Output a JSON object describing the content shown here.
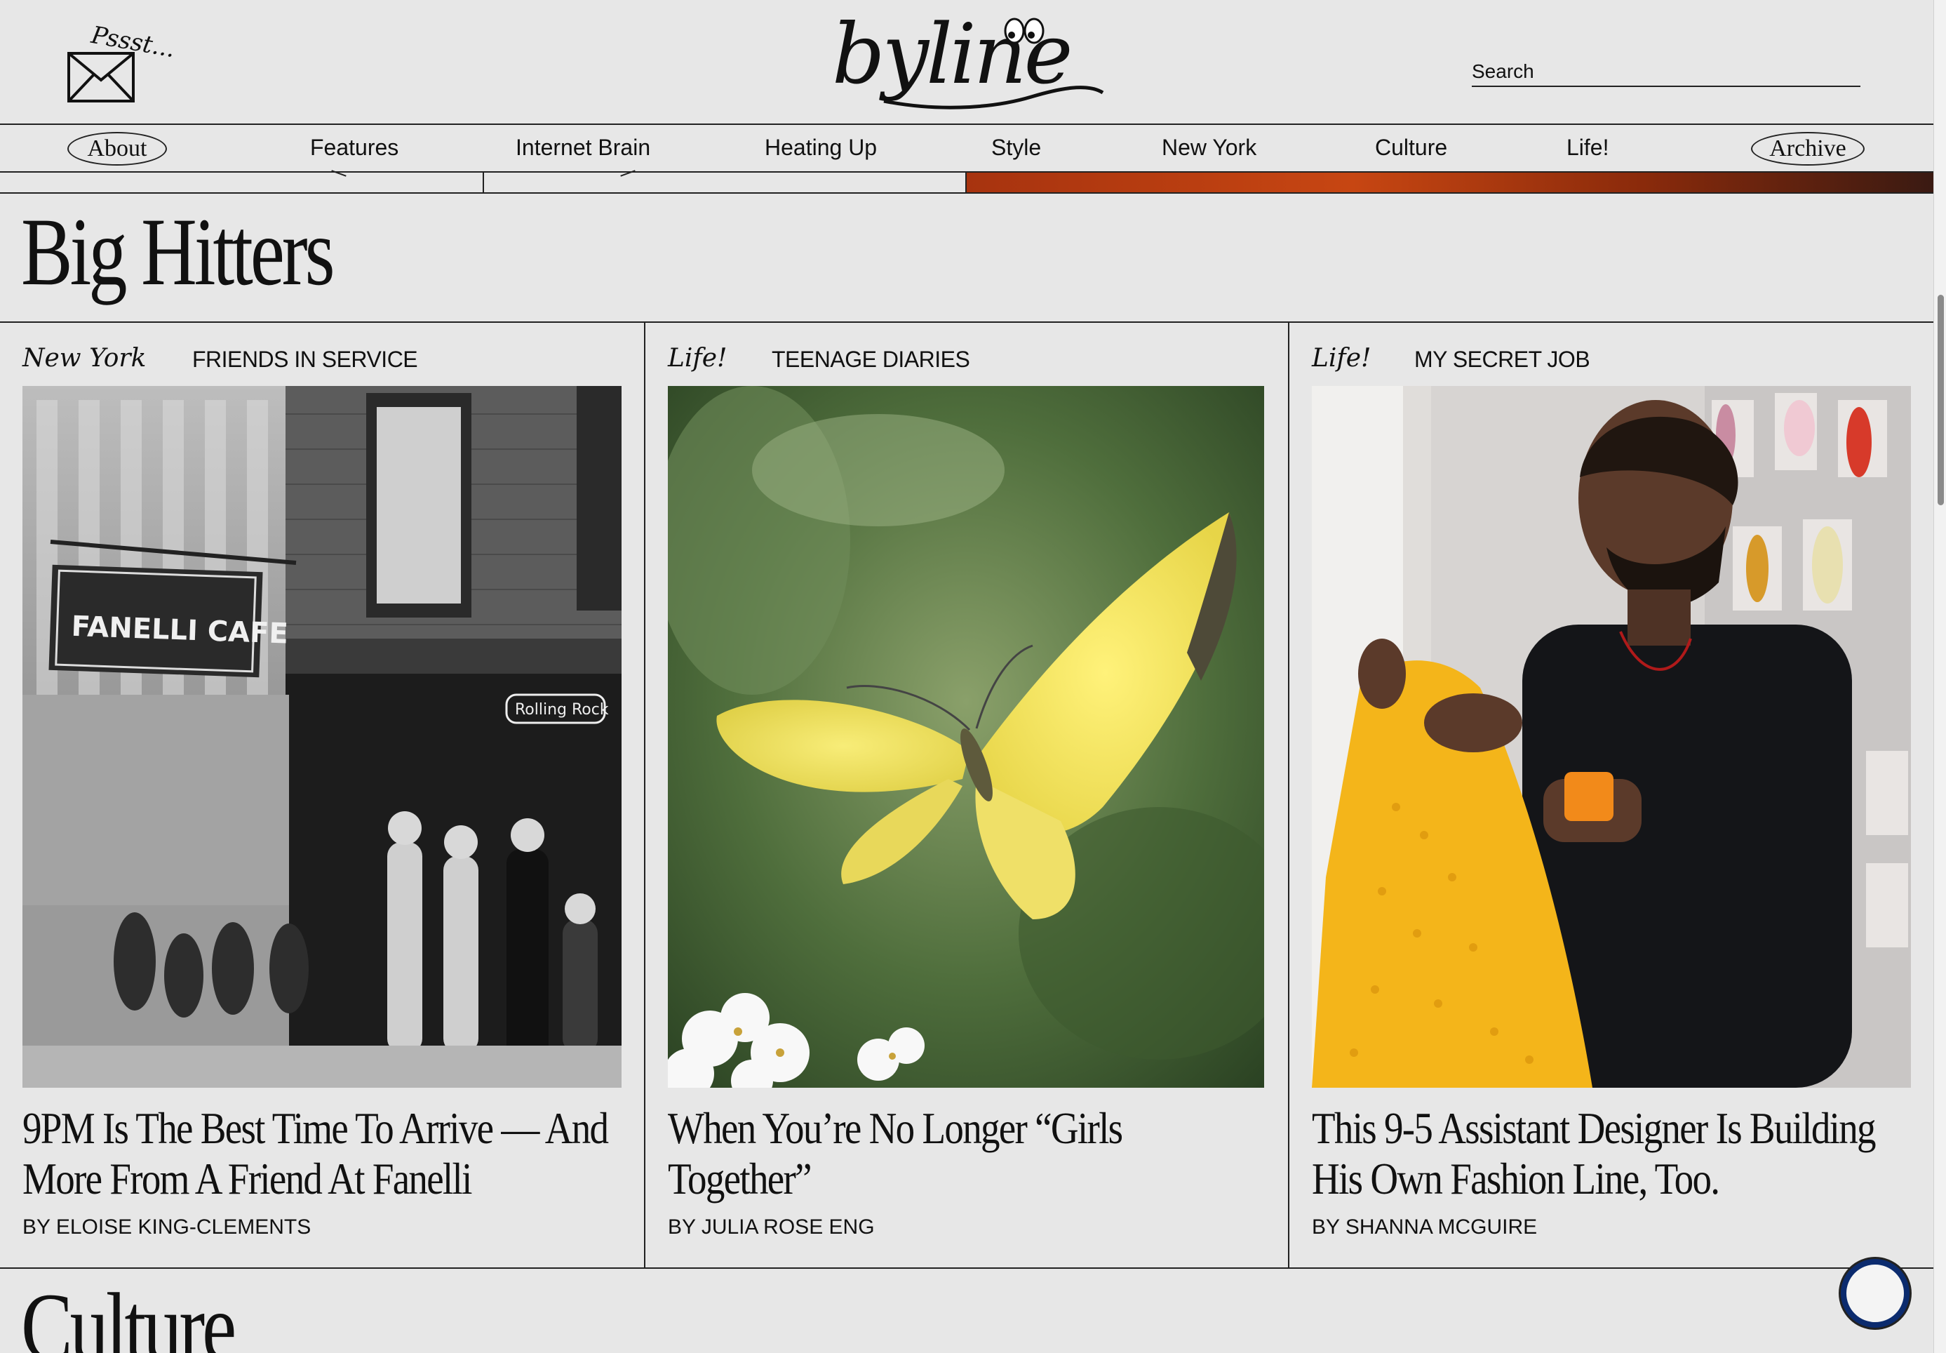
{
  "header": {
    "psst_text": "Pssst...",
    "logo_text": "byline",
    "search_label": "Search"
  },
  "nav": {
    "about": "About",
    "items": [
      "Features",
      "Internet Brain",
      "Heating Up",
      "Style",
      "New York",
      "Culture",
      "Life!"
    ],
    "archive": "Archive"
  },
  "section": {
    "title": "Big Hitters",
    "next_title": "Culture"
  },
  "cards": [
    {
      "category": "New York",
      "series": "FRIENDS IN SERVICE",
      "title": "9PM Is The Best Time To Arrive — And More From A Friend At Fanelli",
      "byline": "BY ELOISE KING-CLEMENTS",
      "image_sign": "FANELLI CAFE",
      "image_neon": "Rolling Rock"
    },
    {
      "category": "Life!",
      "series": "TEENAGE DIARIES",
      "title": "When You’re No Longer “Girls Together”",
      "byline": "BY JULIA ROSE ENG"
    },
    {
      "category": "Life!",
      "series": "MY SECRET JOB",
      "title": "This 9-5 Assistant Designer Is Building His Own Fashion Line, Too.",
      "byline": "BY SHANNA MCGUIRE"
    }
  ],
  "colors": {
    "background": "#e7e7e7",
    "ink": "#111111",
    "strip_accent": "#c74612",
    "button_ring": "#0b2b6e"
  }
}
